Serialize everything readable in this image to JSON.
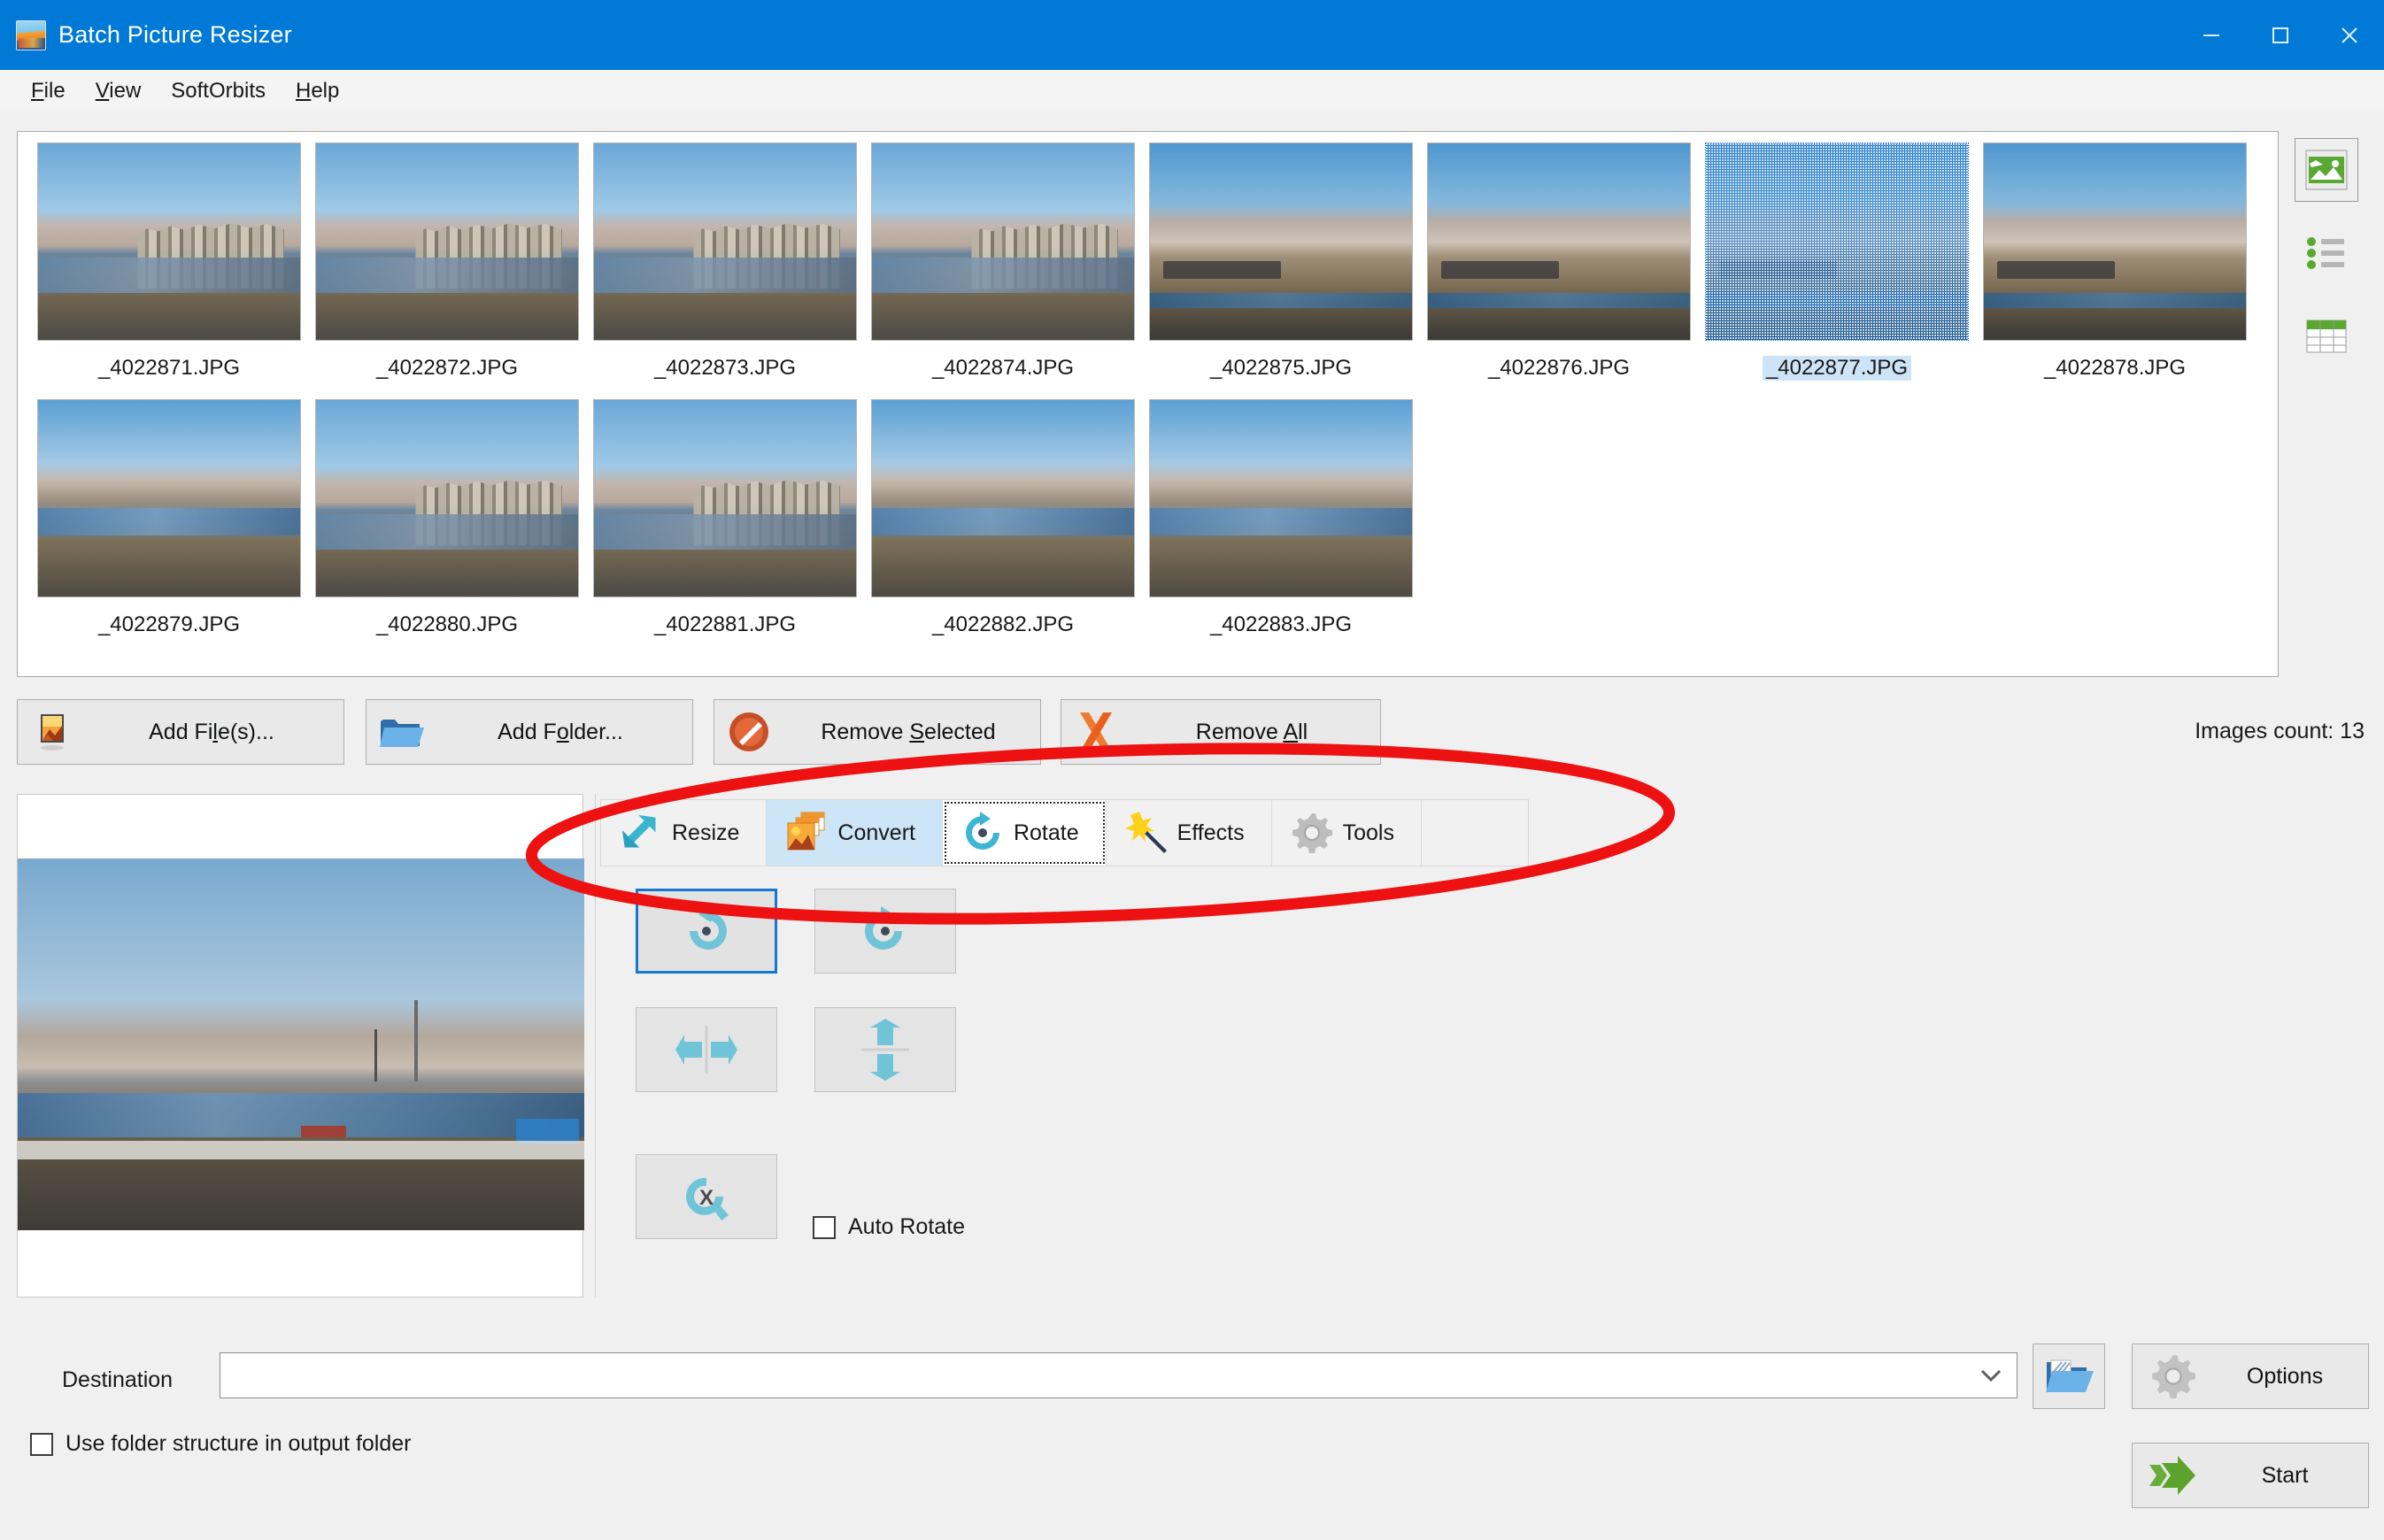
{
  "window": {
    "title": "Batch Picture Resizer",
    "icon": "app-picture-icon",
    "controls": {
      "minimize": "–",
      "maximize": "□",
      "close": "×"
    }
  },
  "menu": {
    "items": [
      {
        "label": "File",
        "mnemonic": "F"
      },
      {
        "label": "View",
        "mnemonic": "V"
      },
      {
        "label": "SoftOrbits",
        "mnemonic": ""
      },
      {
        "label": "Help",
        "mnemonic": "H"
      }
    ]
  },
  "thumbnails": {
    "items": [
      {
        "name": "_4022871.JPG",
        "style": "ph-city",
        "selected": false
      },
      {
        "name": "_4022872.JPG",
        "style": "ph-city",
        "selected": false
      },
      {
        "name": "_4022873.JPG",
        "style": "ph-city",
        "selected": false
      },
      {
        "name": "_4022874.JPG",
        "style": "ph-city",
        "selected": false
      },
      {
        "name": "_4022875.JPG",
        "style": "ph-water",
        "selected": false
      },
      {
        "name": "_4022876.JPG",
        "style": "ph-water",
        "selected": false
      },
      {
        "name": "_4022877.JPG",
        "style": "ph-water",
        "selected": true
      },
      {
        "name": "_4022878.JPG",
        "style": "ph-water",
        "selected": false
      },
      {
        "name": "_4022879.JPG",
        "style": "ph-coast",
        "selected": false
      },
      {
        "name": "_4022880.JPG",
        "style": "ph-city",
        "selected": false
      },
      {
        "name": "_4022881.JPG",
        "style": "ph-city",
        "selected": false
      },
      {
        "name": "_4022882.JPG",
        "style": "ph-coast",
        "selected": false
      },
      {
        "name": "_4022883.JPG",
        "style": "ph-coast",
        "selected": false
      }
    ]
  },
  "view_modes": [
    {
      "name": "thumbnails-view",
      "icon": "picture-icon",
      "active": true
    },
    {
      "name": "list-view",
      "icon": "list-icon",
      "active": false
    },
    {
      "name": "details-view",
      "icon": "table-icon",
      "active": false
    }
  ],
  "actions": {
    "add_files": {
      "label": "Add File(s)...",
      "mnemonic": "l",
      "icon": "picture-file-icon"
    },
    "add_folder": {
      "label": "Add Folder...",
      "mnemonic": "o",
      "icon": "folder-icon"
    },
    "remove_selected": {
      "label": "Remove Selected",
      "mnemonic": "S",
      "icon": "no-entry-icon"
    },
    "remove_all": {
      "label": "Remove All",
      "mnemonic": "A",
      "icon": "orange-x-icon"
    },
    "images_count": "Images count: 13"
  },
  "tabs": [
    {
      "label": "Resize",
      "icon": "resize-arrow-icon",
      "state": "normal"
    },
    {
      "label": "Convert",
      "icon": "convert-images-icon",
      "state": "hovered"
    },
    {
      "label": "Rotate",
      "icon": "rotate-icon",
      "state": "active"
    },
    {
      "label": "Effects",
      "icon": "magic-wand-icon",
      "state": "normal"
    },
    {
      "label": "Tools",
      "icon": "gear-icon",
      "state": "normal"
    }
  ],
  "rotate_panel": {
    "buttons": [
      {
        "name": "rotate-left-button",
        "icon": "rotate-ccw-icon",
        "selected": true
      },
      {
        "name": "rotate-right-button",
        "icon": "rotate-cw-icon",
        "selected": false
      },
      {
        "name": "flip-horizontal-button",
        "icon": "flip-h-icon",
        "selected": false
      },
      {
        "name": "flip-vertical-button",
        "icon": "flip-v-icon",
        "selected": false
      },
      {
        "name": "no-rotate-button",
        "icon": "rotate-cancel-icon",
        "selected": false
      }
    ],
    "auto_rotate": {
      "label": "Auto Rotate",
      "checked": false
    }
  },
  "bottom": {
    "destination_label": "Destination",
    "destination_value": "",
    "destination_placeholder": "",
    "browse_icon": "open-folder-icon",
    "options_label": "Options",
    "options_icon": "gear-icon",
    "start_label": "Start",
    "start_icon": "green-arrow-icon",
    "folder_structure": {
      "label": "Use folder structure in output folder",
      "checked": false
    }
  },
  "annotation": {
    "shape": "ellipse",
    "color": "#ee1111",
    "target": "tabs-toolbar"
  },
  "colors": {
    "titlebar": "#0079d7",
    "window_bg": "#f0f0f0",
    "accent_selection": "#1577cf",
    "tab_hover": "#cce5f7",
    "annotation_red": "#ee1111"
  }
}
